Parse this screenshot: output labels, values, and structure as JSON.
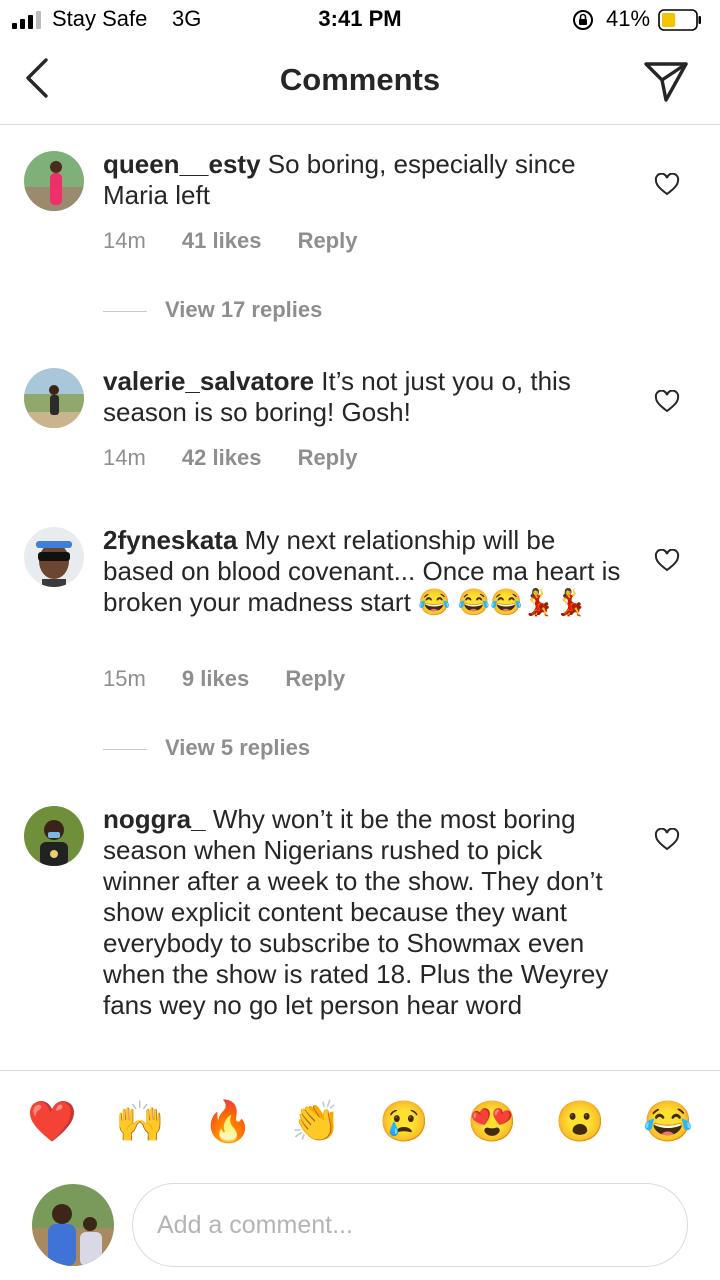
{
  "status_bar": {
    "carrier": "Stay Safe",
    "network": "3G",
    "time": "3:41 PM",
    "battery_percent": "41%",
    "battery_level": 0.41,
    "battery_color": "#f5c400"
  },
  "header": {
    "title": "Comments",
    "back_icon": "chevron-left-icon",
    "share_icon": "paper-plane-icon"
  },
  "comments": [
    {
      "username": "queen__esty",
      "text": "So boring, especially since Maria left",
      "time": "14m",
      "likes": "41 likes",
      "reply_label": "Reply",
      "view_replies": "View 17 replies"
    },
    {
      "username": "valerie_salvatore",
      "text": "It’s not just you o, this season is so boring! Gosh!",
      "time": "14m",
      "likes": "42 likes",
      "reply_label": "Reply"
    },
    {
      "username": "2fyneskata",
      "text": "My next relationship will be based on blood covenant... Once ma heart is broken your madness start 😂 😂😂💃💃",
      "time": "15m",
      "likes": "9 likes",
      "reply_label": "Reply",
      "view_replies": "View 5 replies"
    },
    {
      "username": "noggra_",
      "text": "Why won’t it be the most boring season when Nigerians rushed to pick winner after a week to the show. They don’t show explicit content because they want everybody to subscribe to Showmax even when the show is rated 18. Plus the Weyrey fans wey no go let person hear word"
    }
  ],
  "emoji_bar": [
    "❤️",
    "🙌",
    "🔥",
    "👏",
    "😢",
    "😍",
    "😮",
    "😂"
  ],
  "composer": {
    "placeholder": "Add a comment..."
  }
}
